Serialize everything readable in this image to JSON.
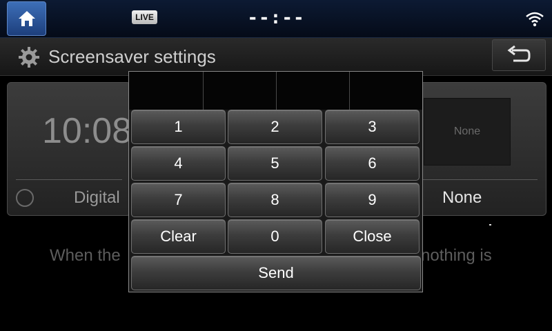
{
  "status_bar": {
    "live_badge": "LIVE",
    "clock": "--:--"
  },
  "title_bar": {
    "title": "Screensaver settings"
  },
  "cards": {
    "digital": {
      "time": "10:08",
      "label": "Digital"
    },
    "none": {
      "preview_text": "None",
      "label": "None"
    }
  },
  "description": {
    "left_fragment": "When the",
    "right_fragment": "nothing is"
  },
  "keypad": {
    "keys": [
      "1",
      "2",
      "3",
      "4",
      "5",
      "6",
      "7",
      "8",
      "9",
      "Clear",
      "0",
      "Close"
    ],
    "send_label": "Send"
  },
  "colors": {
    "home_button": "#2f5ea8",
    "background": "#000000"
  }
}
